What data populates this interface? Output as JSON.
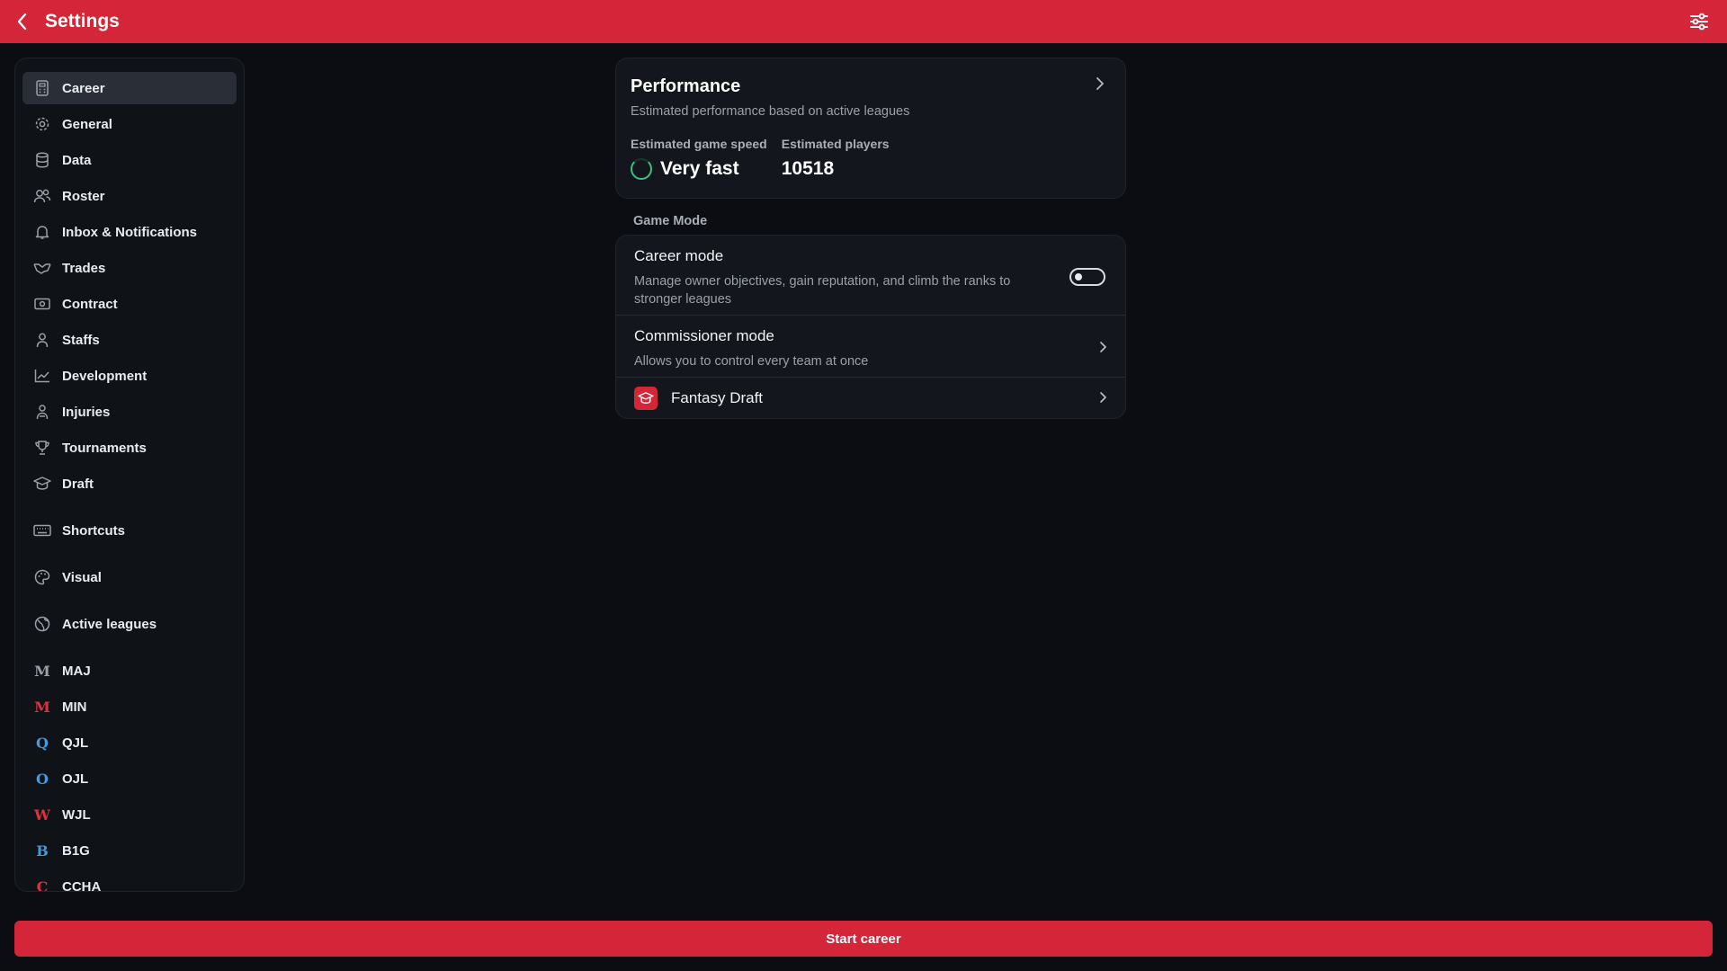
{
  "header": {
    "title": "Settings",
    "back_icon": "chevron-left-icon",
    "settings_icon": "sliders-icon"
  },
  "sidebar": {
    "items": [
      {
        "label": "Career",
        "icon": "calculator-icon",
        "active": true
      },
      {
        "label": "General",
        "icon": "gear-icon"
      },
      {
        "label": "Data",
        "icon": "database-icon"
      },
      {
        "label": "Roster",
        "icon": "users-icon"
      },
      {
        "label": "Inbox & Notifications",
        "icon": "bell-icon"
      },
      {
        "label": "Trades",
        "icon": "handshake-icon"
      },
      {
        "label": "Contract",
        "icon": "money-icon"
      },
      {
        "label": "Staffs",
        "icon": "person-icon"
      },
      {
        "label": "Development",
        "icon": "chart-line-icon"
      },
      {
        "label": "Injuries",
        "icon": "injured-person-icon"
      },
      {
        "label": "Tournaments",
        "icon": "trophy-icon"
      },
      {
        "label": "Draft",
        "icon": "graduation-cap-icon"
      },
      {
        "label": "Shortcuts",
        "icon": "keyboard-icon"
      },
      {
        "label": "Visual",
        "icon": "palette-icon"
      },
      {
        "label": "Active leagues",
        "icon": "globe-icon"
      }
    ],
    "leagues": [
      {
        "label": "MAJ",
        "glyph": "M",
        "color": "#9aa0aa"
      },
      {
        "label": "MIN",
        "glyph": "M",
        "color": "#e0313f"
      },
      {
        "label": "QJL",
        "glyph": "Q",
        "color": "#3e9be6"
      },
      {
        "label": "OJL",
        "glyph": "O",
        "color": "#3e9be6"
      },
      {
        "label": "WJL",
        "glyph": "W",
        "color": "#e0313f"
      },
      {
        "label": "B1G",
        "glyph": "B",
        "color": "#3e9be6"
      },
      {
        "label": "CCHA",
        "glyph": "C",
        "color": "#e0313f"
      }
    ]
  },
  "performance": {
    "title": "Performance",
    "subtitle": "Estimated performance based on active leagues",
    "speed_label": "Estimated game speed",
    "speed_value": "Very fast",
    "players_label": "Estimated players",
    "players_value": "10518",
    "ring_color": "#36c57a"
  },
  "game_mode": {
    "section_label": "Game Mode",
    "career": {
      "title": "Career mode",
      "description": "Manage owner objectives, gain reputation, and climb the ranks to stronger leagues",
      "toggle_on": false
    },
    "commissioner": {
      "title": "Commissioner mode",
      "description": "Allows you to control every team at once"
    },
    "fantasy": {
      "title": "Fantasy Draft",
      "icon": "graduation-cap-icon"
    }
  },
  "footer": {
    "start_label": "Start career"
  },
  "colors": {
    "accent": "#d42638",
    "background": "#0b0d12",
    "card": "#13161c"
  }
}
